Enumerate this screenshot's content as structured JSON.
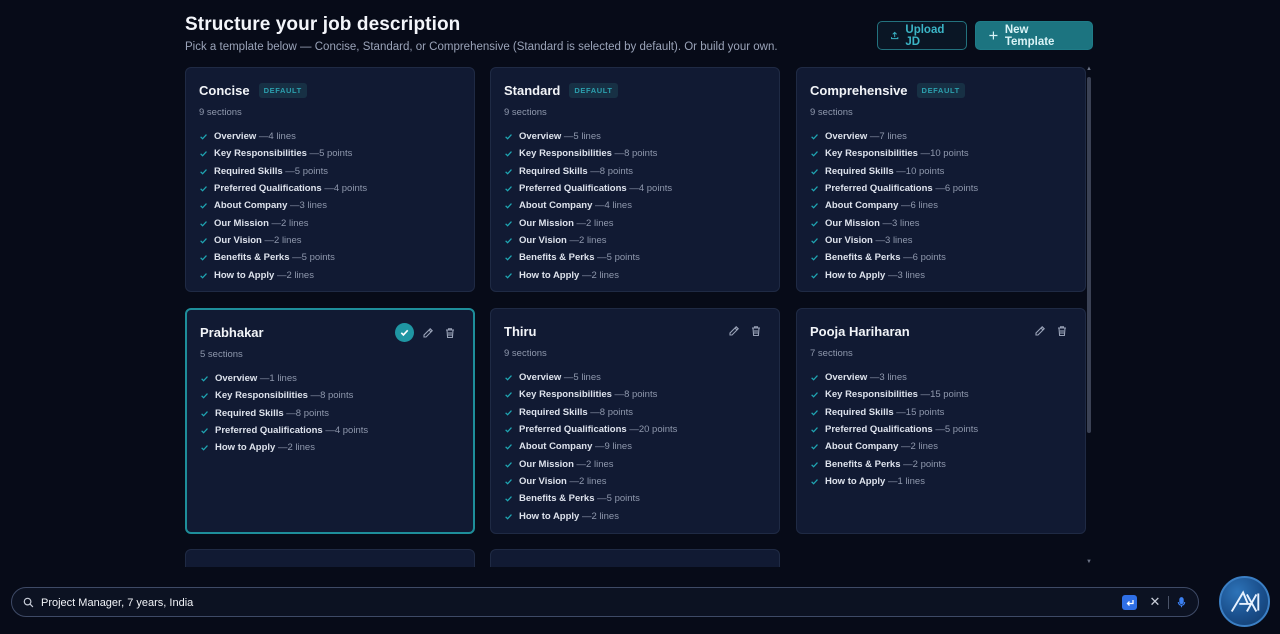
{
  "header": {
    "title": "Structure your job description",
    "subtitle": "Pick a template below — Concise, Standard, or Comprehensive (Standard is selected by default). Or build your own.",
    "upload_label": "Upload JD",
    "new_template_label": "New Template"
  },
  "colors": {
    "accent": "#1f96a3",
    "background": "#070b18",
    "card": "#111a33",
    "primary_button": "#1c7480"
  },
  "icons": {
    "upload": "upload-icon",
    "plus": "plus-icon",
    "check": "check-icon",
    "edit": "pencil-icon",
    "delete": "trash-icon",
    "search": "search-icon",
    "enter": "enter-icon",
    "clear": "close-icon",
    "mic": "microphone-icon",
    "assistant": "ai-assistant-icon"
  },
  "cards": [
    {
      "title": "Concise",
      "badge": "DEFAULT",
      "count": "9 sections",
      "selected": false,
      "editable": false,
      "sections": [
        {
          "name": "Overview",
          "detail": "4 lines"
        },
        {
          "name": "Key Responsibilities",
          "detail": "5 points"
        },
        {
          "name": "Required Skills",
          "detail": "5 points"
        },
        {
          "name": "Preferred Qualifications",
          "detail": "4 points"
        },
        {
          "name": "About Company",
          "detail": "3 lines"
        },
        {
          "name": "Our Mission",
          "detail": "2 lines"
        },
        {
          "name": "Our Vision",
          "detail": "2 lines"
        },
        {
          "name": "Benefits & Perks",
          "detail": "5 points"
        },
        {
          "name": "How to Apply",
          "detail": "2 lines"
        }
      ]
    },
    {
      "title": "Standard",
      "badge": "DEFAULT",
      "count": "9 sections",
      "selected": false,
      "editable": false,
      "sections": [
        {
          "name": "Overview",
          "detail": "5 lines"
        },
        {
          "name": "Key Responsibilities",
          "detail": "8 points"
        },
        {
          "name": "Required Skills",
          "detail": "8 points"
        },
        {
          "name": "Preferred Qualifications",
          "detail": "4 points"
        },
        {
          "name": "About Company",
          "detail": "4 lines"
        },
        {
          "name": "Our Mission",
          "detail": "2 lines"
        },
        {
          "name": "Our Vision",
          "detail": "2 lines"
        },
        {
          "name": "Benefits & Perks",
          "detail": "5 points"
        },
        {
          "name": "How to Apply",
          "detail": "2 lines"
        }
      ]
    },
    {
      "title": "Comprehensive",
      "badge": "DEFAULT",
      "count": "9 sections",
      "selected": false,
      "editable": false,
      "sections": [
        {
          "name": "Overview",
          "detail": "7 lines"
        },
        {
          "name": "Key Responsibilities",
          "detail": "10 points"
        },
        {
          "name": "Required Skills",
          "detail": "10 points"
        },
        {
          "name": "Preferred Qualifications",
          "detail": "6 points"
        },
        {
          "name": "About Company",
          "detail": "6 lines"
        },
        {
          "name": "Our Mission",
          "detail": "3 lines"
        },
        {
          "name": "Our Vision",
          "detail": "3 lines"
        },
        {
          "name": "Benefits & Perks",
          "detail": "6 points"
        },
        {
          "name": "How to Apply",
          "detail": "3 lines"
        }
      ]
    },
    {
      "title": "Prabhakar",
      "badge": "",
      "count": "5 sections",
      "selected": true,
      "editable": true,
      "sections": [
        {
          "name": "Overview",
          "detail": "1 lines"
        },
        {
          "name": "Key Responsibilities",
          "detail": "8 points"
        },
        {
          "name": "Required Skills",
          "detail": "8 points"
        },
        {
          "name": "Preferred Qualifications",
          "detail": "4 points"
        },
        {
          "name": "How to Apply",
          "detail": "2 lines"
        }
      ]
    },
    {
      "title": "Thiru",
      "badge": "",
      "count": "9 sections",
      "selected": false,
      "editable": true,
      "sections": [
        {
          "name": "Overview",
          "detail": "5 lines"
        },
        {
          "name": "Key Responsibilities",
          "detail": "8 points"
        },
        {
          "name": "Required Skills",
          "detail": "8 points"
        },
        {
          "name": "Preferred Qualifications",
          "detail": "20 points"
        },
        {
          "name": "About Company",
          "detail": "9 lines"
        },
        {
          "name": "Our Mission",
          "detail": "2 lines"
        },
        {
          "name": "Our Vision",
          "detail": "2 lines"
        },
        {
          "name": "Benefits & Perks",
          "detail": "5 points"
        },
        {
          "name": "How to Apply",
          "detail": "2 lines"
        }
      ]
    },
    {
      "title": "Pooja Hariharan",
      "badge": "",
      "count": "7 sections",
      "selected": false,
      "editable": true,
      "sections": [
        {
          "name": "Overview",
          "detail": "3 lines"
        },
        {
          "name": "Key Responsibilities",
          "detail": "15 points"
        },
        {
          "name": "Required Skills",
          "detail": "15 points"
        },
        {
          "name": "Preferred Qualifications",
          "detail": "5 points"
        },
        {
          "name": "About Company",
          "detail": "2 lines"
        },
        {
          "name": "Benefits & Perks",
          "detail": "2 points"
        },
        {
          "name": "How to Apply",
          "detail": "1 lines"
        }
      ]
    },
    {
      "title": "",
      "badge": "",
      "count": "",
      "selected": false,
      "editable": true,
      "sections": []
    },
    {
      "title": "",
      "badge": "",
      "count": "",
      "selected": false,
      "editable": true,
      "sections": []
    }
  ],
  "search": {
    "value": "Project Manager, 7 years, India",
    "placeholder": ""
  }
}
